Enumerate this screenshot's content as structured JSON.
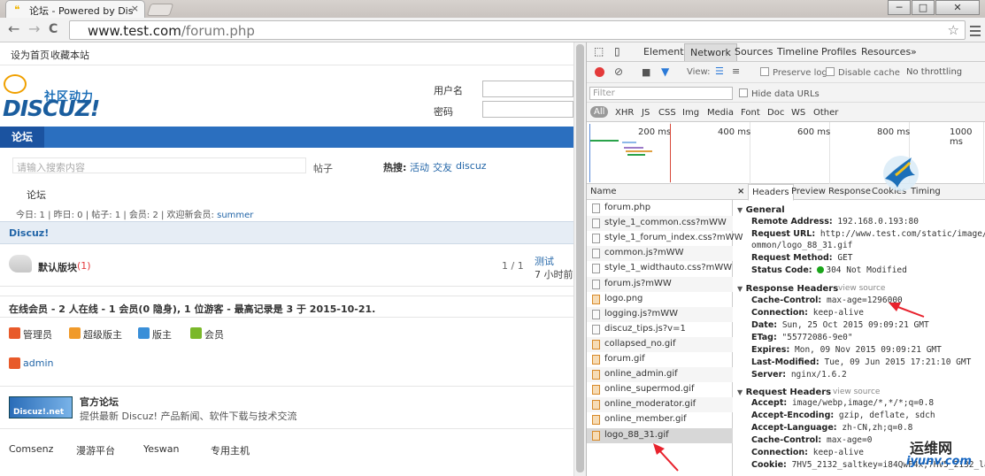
{
  "browser": {
    "tab_title": "论坛 - Powered by Discuz!",
    "url_host": "www.test.com",
    "url_path": "/forum.php",
    "win_min": "─",
    "win_max": "□",
    "win_close": "✕",
    "tab_close": "×",
    "back": "←",
    "forward": "→",
    "reload": "C",
    "star": "☆"
  },
  "site": {
    "topbar": [
      "设为首页",
      "收藏本站"
    ],
    "logo_text": "DISCUZ!",
    "logo_sub": "社区动力",
    "login": {
      "user_label": "用户名",
      "pass_label": "密码"
    },
    "nav_tab": "论坛",
    "search": {
      "placeholder": "请输入搜索内容",
      "scope": "帖子",
      "hot_label": "热搜:",
      "hot": [
        "活动",
        "交友",
        "discuz"
      ]
    },
    "breadcrumb": "论坛",
    "stats_prefix": "今日: 1 | 昨日: 0 | 帖子: 1 | 会员: 2 | 欢迎新会员: ",
    "stats_newuser": "summer",
    "category": "Discuz!",
    "forum": {
      "name": "默认版块",
      "count": "(1)",
      "posts": "1 / 1",
      "last_title": "测试",
      "last_time": "7 小时前 -"
    },
    "online": "在线会员 - 2 人在线 - 1 会员(0 隐身), 1 位游客 - 最高记录是 3 于 2015-10-21.",
    "legend": [
      {
        "label": "管理员",
        "color": "#e85a2a"
      },
      {
        "label": "超级版主",
        "color": "#f09a2a"
      },
      {
        "label": "版主",
        "color": "#3a8fd8"
      },
      {
        "label": "会员",
        "color": "#7ab82a"
      }
    ],
    "online_user": "admin",
    "links": {
      "badge_text": "Discuz!.net",
      "title": "官方论坛",
      "desc": "提供最新 Discuz! 产品新闻、软件下载与技术交流"
    },
    "footer_links": [
      "Comsenz",
      "漫游平台",
      "Yeswan",
      "专用主机"
    ]
  },
  "devtools": {
    "tabs": [
      "Elements",
      "Network",
      "Sources",
      "Timeline",
      "Profiles",
      "Resources",
      "»"
    ],
    "selected_tab": "Network",
    "view_label": "View:",
    "preserve_log": "Preserve log",
    "disable_cache": "Disable cache",
    "throttling": "No throttling",
    "filter_placeholder": "Filter",
    "hide_data_urls": "Hide data URLs",
    "filter_types": [
      "All",
      "XHR",
      "JS",
      "CSS",
      "Img",
      "Media",
      "Font",
      "Doc",
      "WS",
      "Other"
    ],
    "timeline_ticks": [
      "200 ms",
      "400 ms",
      "600 ms",
      "800 ms",
      "1000 ms"
    ],
    "name_header": "Name",
    "requests": [
      "forum.php",
      "style_1_common.css?mWW",
      "style_1_forum_index.css?mWW",
      "common.js?mWW",
      "style_1_widthauto.css?mWW",
      "forum.js?mWW",
      "logo.png",
      "logging.js?mWW",
      "discuz_tips.js?v=1",
      "collapsed_no.gif",
      "forum.gif",
      "online_admin.gif",
      "online_supermod.gif",
      "online_moderator.gif",
      "online_member.gif",
      "logo_88_31.gif"
    ],
    "selected_request": "logo_88_31.gif",
    "detail_tabs": [
      "×",
      "Headers",
      "Preview",
      "Response",
      "Cookies",
      "Timing"
    ],
    "general": {
      "title": "General",
      "remote_label": "Remote Address:",
      "remote": "192.168.0.193:80",
      "url_label": "Request URL:",
      "url_line1": "http://www.test.com/static/image/c",
      "url_line2": "ommon/logo_88_31.gif",
      "method_label": "Request Method:",
      "method": "GET",
      "status_label": "Status Code:",
      "status": "304 Not Modified"
    },
    "response_headers": {
      "title": "Response Headers",
      "view_source": "view source",
      "lines": [
        [
          "Cache-Control:",
          "max-age=1296000"
        ],
        [
          "Connection:",
          "keep-alive"
        ],
        [
          "Date:",
          "Sun, 25 Oct 2015 09:09:21 GMT"
        ],
        [
          "ETag:",
          "\"55772086-9e0\""
        ],
        [
          "Expires:",
          "Mon, 09 Nov 2015 09:09:21 GMT"
        ],
        [
          "Last-Modified:",
          "Tue, 09 Jun 2015 17:21:10 GMT"
        ],
        [
          "Server:",
          "nginx/1.6.2"
        ]
      ]
    },
    "request_headers": {
      "title": "Request Headers",
      "view_source": "view source",
      "lines": [
        [
          "Accept:",
          "image/webp,image/*,*/*;q=0.8"
        ],
        [
          "Accept-Encoding:",
          "gzip, deflate, sdch"
        ],
        [
          "Accept-Language:",
          "zh-CN,zh;q=0.8"
        ],
        [
          "Cache-Control:",
          "max-age=0"
        ],
        [
          "Connection:",
          "keep-alive"
        ],
        [
          "Cookie:",
          "7HV5_2132_saltkey=i84QwF4x;7HV5_2132_lastvi"
        ]
      ]
    }
  },
  "watermark": {
    "cn": "运维网",
    "url": "iyunv.com"
  },
  "colors": {
    "nav_blue": "#2b6fbf",
    "link_blue": "#2366a8",
    "annotation_red": "#e8222d"
  }
}
